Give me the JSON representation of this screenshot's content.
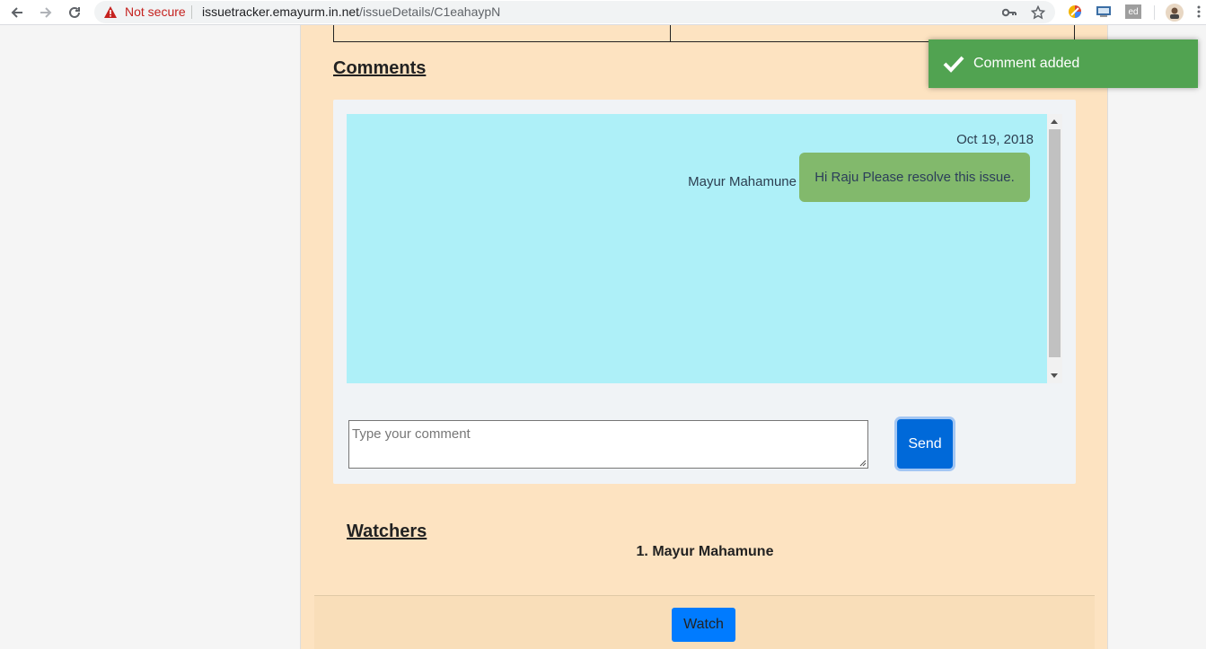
{
  "browser": {
    "security_label": "Not secure",
    "url_host": "issuetracker.emayurm.in.net",
    "url_path": "/issueDetails/C1eahaypN",
    "extension_label": "ed"
  },
  "comments": {
    "heading": "Comments",
    "items": [
      {
        "date": "Oct 19, 2018",
        "author": "Mayur Mahamune",
        "text": "Hi Raju Please resolve this issue."
      }
    ],
    "input_placeholder": "Type your comment",
    "send_label": "Send"
  },
  "watchers": {
    "heading": "Watchers",
    "items": [
      "1. Mayur Mahamune"
    ],
    "watch_label": "Watch"
  },
  "toast": {
    "message": "Comment added"
  },
  "colors": {
    "page_bg": "#fde3c1",
    "chat_bg": "#aef0f8",
    "bubble": "#82b96c",
    "send": "#0069d9",
    "watch": "#007bff",
    "toast": "#51a351",
    "warning": "#c5221f"
  }
}
